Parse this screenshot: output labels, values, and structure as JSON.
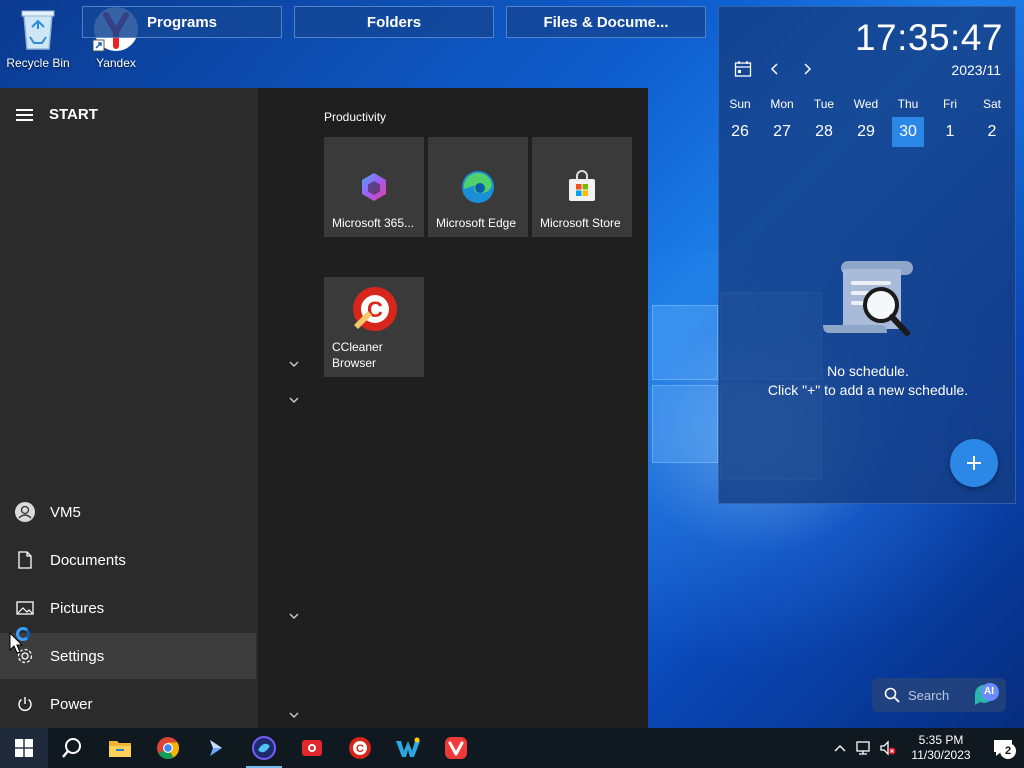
{
  "desktop": {
    "icons": [
      {
        "label": "Recycle Bin",
        "icon": "recycle-bin-icon"
      },
      {
        "label": "Yandex",
        "icon": "yandex-browser-icon"
      }
    ],
    "fences": [
      {
        "label": "Programs"
      },
      {
        "label": "Folders"
      },
      {
        "label": "Files & Docume..."
      }
    ]
  },
  "start_menu": {
    "title": "START",
    "sidebar": [
      {
        "label": "VM5",
        "icon": "user-avatar-icon"
      },
      {
        "label": "Documents",
        "icon": "document-icon"
      },
      {
        "label": "Pictures",
        "icon": "pictures-icon"
      },
      {
        "label": "Settings",
        "icon": "gear-icon",
        "hovered": true
      },
      {
        "label": "Power",
        "icon": "power-icon"
      }
    ],
    "group_title": "Productivity",
    "tiles": [
      {
        "label": "Microsoft 365...",
        "icon": "microsoft-365-icon"
      },
      {
        "label": "Microsoft Edge",
        "icon": "edge-icon"
      },
      {
        "label": "Microsoft Store",
        "icon": "store-icon"
      },
      {
        "label": "CCleaner Browser",
        "icon": "ccleaner-icon"
      }
    ]
  },
  "calendar": {
    "time": "17:35:47",
    "month": "2023/11",
    "weekdays": [
      "Sun",
      "Mon",
      "Tue",
      "Wed",
      "Thu",
      "Fri",
      "Sat"
    ],
    "days": [
      "26",
      "27",
      "28",
      "29",
      "30",
      "1",
      "2"
    ],
    "today": "30",
    "empty_line1": "No schedule.",
    "empty_line2": "Click \"+\" to add a new schedule.",
    "accent": "#2b88e6"
  },
  "search_widget": {
    "placeholder": "Search",
    "ai_label": "AI"
  },
  "taskbar": {
    "apps": [
      "windows-start-icon",
      "search-icon",
      "file-explorer-icon",
      "chrome-icon",
      "arrow-app-icon",
      "nexus-app-icon",
      "screen-recorder-icon",
      "ccleaner-icon",
      "wise-app-icon",
      "vivaldi-icon"
    ],
    "time": "5:35 PM",
    "date": "11/30/2023",
    "notification_count": "2"
  }
}
